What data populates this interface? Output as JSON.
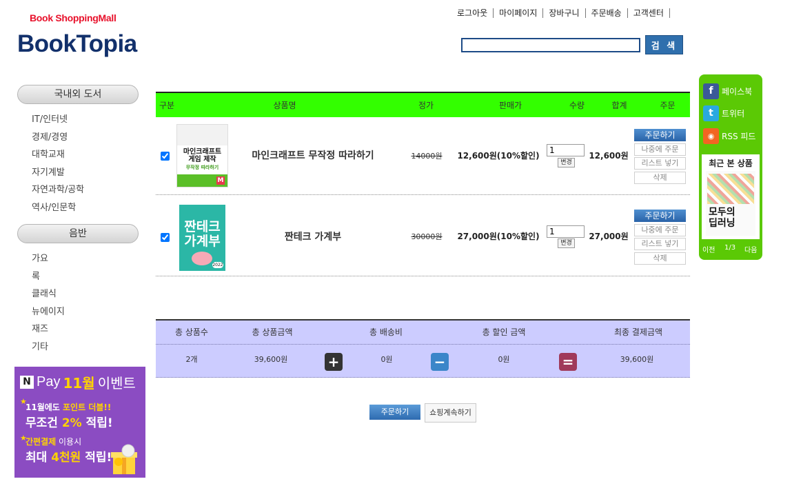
{
  "brand": {
    "tagline": "Book ShoppingMall",
    "logo": "BookTopia"
  },
  "topnav": [
    "로그아웃",
    "마이페이지",
    "장바구니",
    "주문배송",
    "고객센터"
  ],
  "search": {
    "value": "",
    "button": "검 색"
  },
  "sidebar": {
    "sections": [
      {
        "title": "국내외 도서",
        "items": [
          "IT/인터넷",
          "경제/경영",
          "대학교재",
          "자기계발",
          "자연과학/공학",
          "역사/인문학"
        ]
      },
      {
        "title": "음반",
        "items": [
          "가요",
          "록",
          "클래식",
          "뉴에이지",
          "재즈",
          "기타"
        ]
      }
    ]
  },
  "banner": {
    "pay_brand": "N",
    "pay_word": "Pay",
    "month": "11월",
    "event": "이벤트",
    "line1_prefix": "11월",
    "line1_mid": "에도 ",
    "line1_highlight": "포인트 더블!!",
    "line2_prefix": "무조건 ",
    "line2_highlight": "2%",
    "line2_suffix": " 적립!",
    "line3_highlight": "간편결제",
    "line3_suffix": " 이용시",
    "line4_prefix": "최대 ",
    "line4_highlight": "4천원",
    "line4_suffix": " 적립!"
  },
  "cart": {
    "headers": [
      "구분",
      "상품명",
      "정가",
      "판매가",
      "수량",
      "합계",
      "주문"
    ],
    "items": [
      {
        "checked": true,
        "title": "마인크래프트 무작정 따라하기",
        "cover_lines": [
          "마인크래프트",
          "게임 제작",
          "무작정 따라하기"
        ],
        "list_price": "14000원",
        "sale_price": "12,600원(10%할인)",
        "qty": "1",
        "total": "12,600원"
      },
      {
        "checked": true,
        "title": "짠테크 가계부",
        "cover_lines": [
          "짠테크",
          "가계부",
          "2022"
        ],
        "list_price": "30000원",
        "sale_price": "27,000원(10%할인)",
        "qty": "1",
        "total": "27,000원"
      }
    ],
    "row_buttons": {
      "change": "변경",
      "order": "주문하기",
      "later": "나중에 주문",
      "wishlist": "리스트 넣기",
      "delete": "삭제"
    }
  },
  "summary": {
    "headers": [
      "총 상품수",
      "총 상품금액",
      "총 배송비",
      "총 할인 금액",
      "최종 결제금액"
    ],
    "values": [
      "2개",
      "39,600원",
      "0원",
      "0원",
      "39,600원"
    ],
    "operators": [
      "+",
      "−",
      "="
    ],
    "operator_colors": [
      "#333333",
      "#3b86c9",
      "#a03a5a"
    ]
  },
  "actions": {
    "order": "주문하기",
    "continue": "쇼핑계속하기"
  },
  "side_panel": {
    "links": [
      {
        "label": "페이스북",
        "icon": "facebook-icon",
        "glyph": "f",
        "color": "#3b5998"
      },
      {
        "label": "트위터",
        "icon": "twitter-icon",
        "glyph": "t",
        "color": "#2aa9e0"
      },
      {
        "label": "RSS 피드",
        "icon": "rss-icon",
        "glyph": "◉",
        "color": "#f26522"
      }
    ],
    "recent_title": "최근 본 상품",
    "recent_book_lines": [
      "모두의",
      "딥러닝"
    ],
    "prev": "이전",
    "page": "1/3",
    "next": "다음"
  },
  "colors": {
    "table_header": "#33ff00",
    "summary_bg": "#ccccff",
    "side_panel": "#5bc905",
    "brand_navy": "#12306b",
    "brand_red": "#e8102a"
  }
}
